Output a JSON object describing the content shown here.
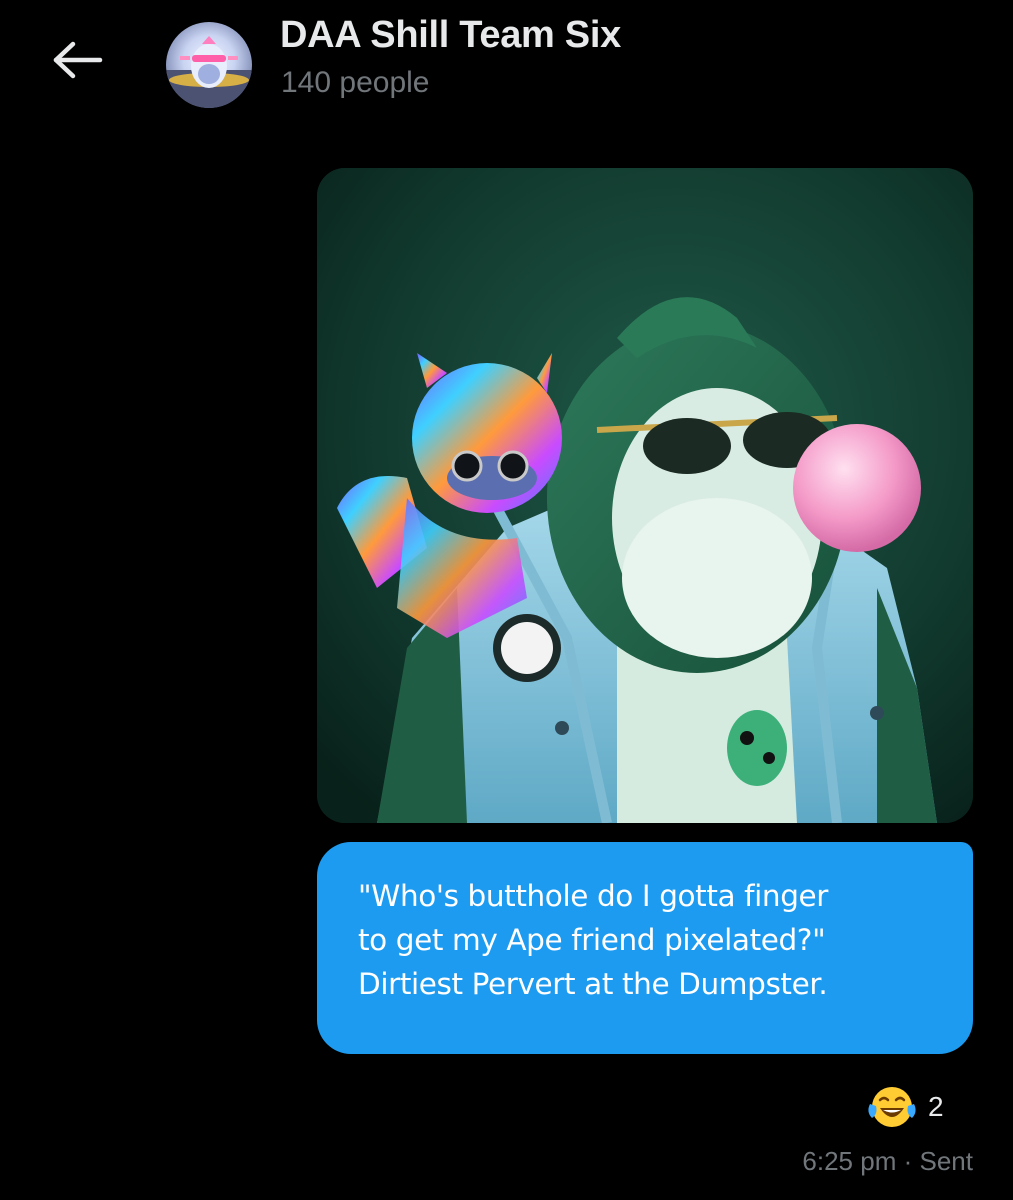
{
  "header": {
    "back_icon": "arrow-left-icon",
    "group_name": "DAA Shill Team Six",
    "member_count": "140 people"
  },
  "message": {
    "image_description_icon": "nft-image",
    "text": "\"Who's butthole do I gotta finger to get my Ape friend pixelated?\" Dirtiest Pervert at the Dumpster.",
    "text_lines": [
      "\"Who's butthole do I gotta finger",
      "to get my Ape friend pixelated?\"",
      "Dirtiest Pervert at the Dumpster."
    ],
    "reaction": {
      "emoji_icon": "face-with-tears-of-joy-icon",
      "count": "2"
    },
    "time": "6:25 pm",
    "separator": "·",
    "status": "Sent"
  },
  "colors": {
    "background": "#000000",
    "bubble": "#1d9bf0",
    "primary_text": "#e7e9ea",
    "secondary_text": "#71767b"
  }
}
